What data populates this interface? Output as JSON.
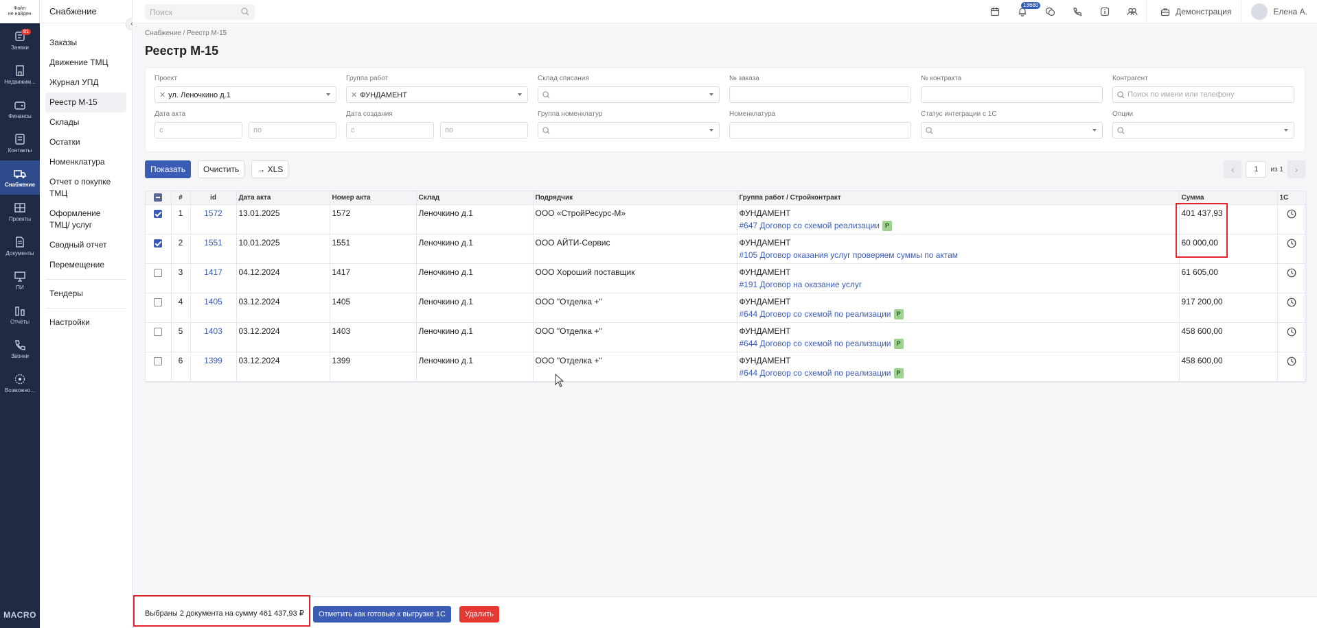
{
  "rail": {
    "logo": [
      "Файл",
      "не найден"
    ],
    "items": [
      {
        "label": "Заявки",
        "icon": "requests-icon",
        "badge": "81"
      },
      {
        "label": "Недвижим...",
        "icon": "building-icon"
      },
      {
        "label": "Финансы",
        "icon": "wallet-icon"
      },
      {
        "label": "Контакты",
        "icon": "contacts-icon"
      },
      {
        "label": "Снабжение",
        "icon": "truck-icon",
        "active": true
      },
      {
        "label": "Проекты",
        "icon": "projects-icon"
      },
      {
        "label": "Документы",
        "icon": "documents-icon"
      },
      {
        "label": "ПИ",
        "icon": "presentation-icon"
      },
      {
        "label": "Отчёты",
        "icon": "reports-icon"
      },
      {
        "label": "Звонки",
        "icon": "phone-icon"
      },
      {
        "label": "Возможно...",
        "icon": "settings-icon"
      }
    ],
    "bottom": "MACRO"
  },
  "sidebar": {
    "title": "Снабжение",
    "items": [
      "Заказы",
      "Движение ТМЦ",
      "Журнал УПД",
      "Реестр М-15",
      "Склады",
      "Остатки",
      "Номенклатура",
      "Отчет о покупке ТМЦ",
      "Оформление ТМЦ/ услуг",
      "Сводный отчет",
      "Перемещение"
    ],
    "items2": [
      "Тендеры"
    ],
    "items3": [
      "Настройки"
    ],
    "active": "Реестр М-15"
  },
  "topbar": {
    "search_placeholder": "Поиск",
    "notif_count": "13660",
    "demo": "Демонстрация",
    "user": "Елена А."
  },
  "breadcrumb": "Снабжение / Реестр М-15",
  "page_title": "Реестр М-15",
  "filters": {
    "project": {
      "label": "Проект",
      "value": "ул. Леночкино д.1"
    },
    "work_group": {
      "label": "Группа работ",
      "value": "ФУНДАМЕНТ"
    },
    "warehouse": {
      "label": "Склад списания"
    },
    "order_no": {
      "label": "№ заказа"
    },
    "contract_no": {
      "label": "№ контракта"
    },
    "counterparty": {
      "label": "Контрагент",
      "placeholder": "Поиск по имени или телефону"
    },
    "act_date": {
      "label": "Дата акта",
      "from": "с",
      "to": "по"
    },
    "created_date": {
      "label": "Дата создания",
      "from": "с",
      "to": "по"
    },
    "nomen_group": {
      "label": "Группа номенклатур"
    },
    "nomen": {
      "label": "Номенклатура"
    },
    "integration_status": {
      "label": "Статус интеграции с 1С"
    },
    "options": {
      "label": "Опции"
    }
  },
  "actions": {
    "show": "Показать",
    "clear": "Очистить",
    "xls": "→ XLS"
  },
  "pager": {
    "page": "1",
    "of": "из 1"
  },
  "table": {
    "headers": [
      "#",
      "id",
      "Дата акта",
      "Номер акта",
      "Склад",
      "Подрядчик",
      "Группа работ / Стройконтракт",
      "Сумма",
      "1С"
    ],
    "rows": [
      {
        "checked": true,
        "n": "1",
        "id": "1572",
        "date": "13.01.2025",
        "act": "1572",
        "warehouse": "Леночкино д.1",
        "contractor": "ООО «СтройРесурс-М»",
        "group": "ФУНДАМЕНТ",
        "contract": "#647 Договор со схемой реализации",
        "badge": "Р",
        "sum": "401 437,93"
      },
      {
        "checked": true,
        "n": "2",
        "id": "1551",
        "date": "10.01.2025",
        "act": "1551",
        "warehouse": "Леночкино д.1",
        "contractor": "ООО АЙТИ-Сервис",
        "group": "ФУНДАМЕНТ",
        "contract": "#105 Договор оказания услуг проверяем суммы по актам",
        "badge": "",
        "sum": "60 000,00"
      },
      {
        "checked": false,
        "n": "3",
        "id": "1417",
        "date": "04.12.2024",
        "act": "1417",
        "warehouse": "Леночкино д.1",
        "contractor": "ООО Хороший поставщик",
        "group": "ФУНДАМЕНТ",
        "contract": "#191 Договор на оказание услуг",
        "badge": "",
        "sum": "61 605,00"
      },
      {
        "checked": false,
        "n": "4",
        "id": "1405",
        "date": "03.12.2024",
        "act": "1405",
        "warehouse": "Леночкино д.1",
        "contractor": "ООО \"Отделка +\"",
        "group": "ФУНДАМЕНТ",
        "contract": "#644 Договор со схемой по реализации",
        "badge": "Р",
        "sum": "917 200,00"
      },
      {
        "checked": false,
        "n": "5",
        "id": "1403",
        "date": "03.12.2024",
        "act": "1403",
        "warehouse": "Леночкино д.1",
        "contractor": "ООО \"Отделка +\"",
        "group": "ФУНДАМЕНТ",
        "contract": "#644 Договор со схемой по реализации",
        "badge": "Р",
        "sum": "458 600,00"
      },
      {
        "checked": false,
        "n": "6",
        "id": "1399",
        "date": "03.12.2024",
        "act": "1399",
        "warehouse": "Леночкино д.1",
        "contractor": "ООО \"Отделка +\"",
        "group": "ФУНДАМЕНТ",
        "contract": "#644 Договор со схемой по реализации",
        "badge": "Р",
        "sum": "458 600,00"
      }
    ]
  },
  "bottombar": {
    "selected_text": "Выбраны 2 документа на сумму 461 437,93 ₽",
    "mark_1c": "Отметить как готовые к выгрузке 1С",
    "delete": "Удалить"
  },
  "colors": {
    "accent": "#3a5cb5",
    "rail": "#1f2a44",
    "danger": "#e53935",
    "highlight": "#e3242b"
  }
}
